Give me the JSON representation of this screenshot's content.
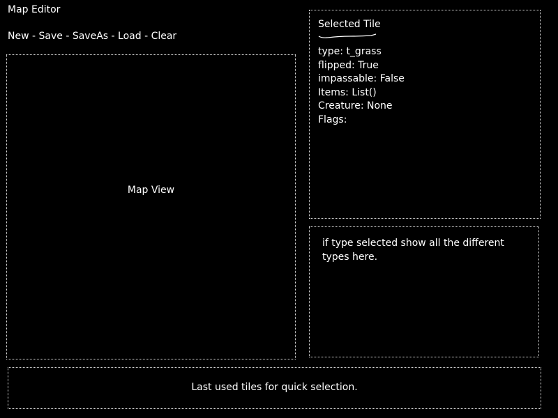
{
  "app": {
    "title": "Map Editor"
  },
  "menu": {
    "items": [
      "New",
      "Save",
      "SaveAs",
      "Load",
      "Clear"
    ],
    "separator": " - "
  },
  "map_view": {
    "label": "Map View"
  },
  "selected_tile": {
    "title": "Selected Tile",
    "properties": [
      "type: t_grass",
      "flipped: True",
      "impassable: False",
      "Items: List()",
      "Creature: None",
      "Flags:"
    ]
  },
  "types_panel": {
    "text": "if type selected show all the different types here."
  },
  "recent_tiles": {
    "label": "Last used tiles for quick selection."
  },
  "colors": {
    "background": "#000000",
    "foreground": "#ffffff",
    "border": "#dcdcdc"
  }
}
